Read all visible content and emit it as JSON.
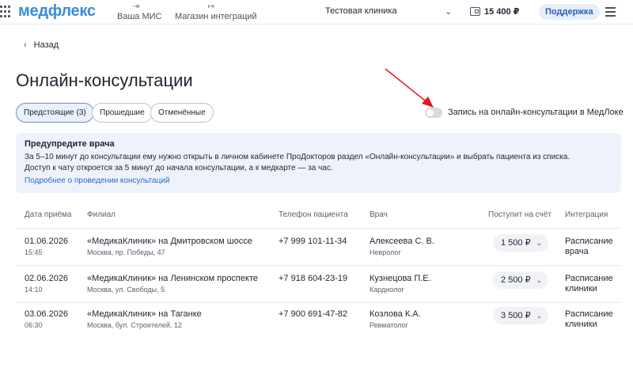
{
  "header": {
    "logo": "медфлекс",
    "nav": [
      {
        "label": "Ваша МИС",
        "icon": "login-icon"
      },
      {
        "label": "Магазин интеграций",
        "icon": "logout-icon"
      }
    ],
    "clinic": "Тестовая клиника",
    "balance": "15 400 ₽",
    "support_label": "Поддержка"
  },
  "back_label": "Назад",
  "page_title": "Онлайн-консультации",
  "tabs": [
    {
      "label": "Предстоящие (3)",
      "active": true
    },
    {
      "label": "Прошедшие",
      "active": false
    },
    {
      "label": "Отменённые",
      "active": false
    }
  ],
  "toggle": {
    "label": "Запись на онлайн-консультации в МедЛоке",
    "on": false
  },
  "annotation": {
    "color": "#e8141b"
  },
  "info": {
    "title": "Предупредите врача",
    "line1": "За 5–10 минут до консультации ему нужно открыть в личном кабинете ПроДокторов раздел «Онлайн-консультации» и выбрать пациента из списка.",
    "line2": "Доступ к чату откроется за 5 минут до начала консультации, а к медкарте — за час.",
    "link": "Подробнее о проведении консультаций"
  },
  "table": {
    "columns": [
      "Дата приёма",
      "Филиал",
      "Телефон пациента",
      "Врач",
      "Поступит на счёт",
      "Интеграция"
    ],
    "rows": [
      {
        "date": "01.06.2026",
        "time": "15:45",
        "branch": "«МедикаКлиник» на Дмитровском шоссе",
        "address": "Москва, пр. Победы, 47",
        "phone": "+7 999 101-11-34",
        "doctor": "Алексеева С. В.",
        "specialty": "Невролог",
        "amount": "1 500 ₽",
        "integration": "Расписание врача"
      },
      {
        "date": "02.06.2026",
        "time": "14:10",
        "branch": "«МедикаКлиник» на Ленинском проспекте",
        "address": "Москва, ул. Свободы, 5",
        "phone": "+7 918 604-23-19",
        "doctor": "Кузнецова П.Е.",
        "specialty": "Кардиолог",
        "amount": "2 500 ₽",
        "integration": "Расписание клиники"
      },
      {
        "date": "03.06.2026",
        "time": "06:30",
        "branch": "«МедикаКлиник» на Таганке",
        "address": "Москва, бул. Строителей, 12",
        "phone": "+7 900 691-47-82",
        "doctor": "Козлова К.А.",
        "specialty": "Ревматолог",
        "amount": "3 500 ₽",
        "integration": "Расписание клиники"
      }
    ]
  }
}
